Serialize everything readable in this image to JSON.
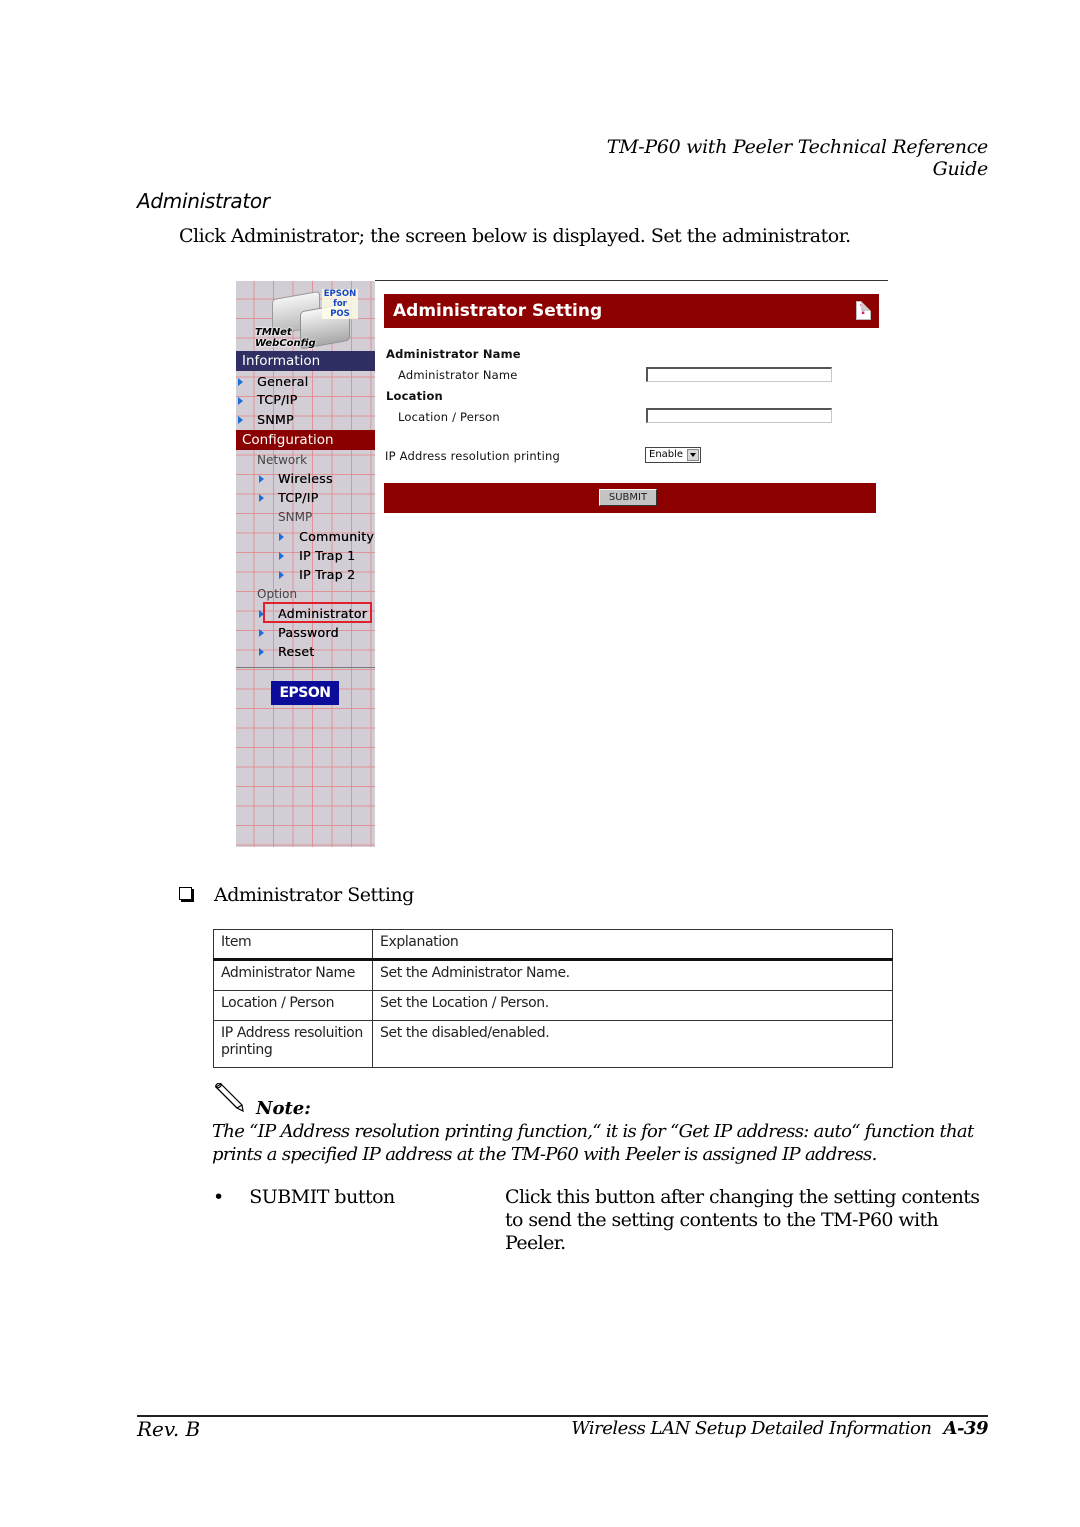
{
  "running_header": "TM-P60 with Peeler Technical Reference Guide",
  "section_title": "Administrator",
  "intro": "Click Administrator; the screen below is displayed. Set the administrator.",
  "screenshot": {
    "logo": {
      "badge_line1": "EPSON",
      "badge_line2": "for",
      "badge_line3": "POS",
      "name_line1": "TMNet",
      "name_line2": "WebConfig"
    },
    "sidebar": {
      "information_header": "Information",
      "information_items": [
        "General",
        "TCP/IP",
        "SNMP"
      ],
      "configuration_header": "Configuration",
      "network_label": "Network",
      "network_items": [
        "Wireless",
        "TCP/IP"
      ],
      "snmp_label": "SNMP",
      "snmp_items": [
        "Community",
        "IP Trap 1",
        "IP Trap 2"
      ],
      "option_label": "Option",
      "option_items": [
        "Administrator",
        "Password",
        "Reset"
      ],
      "selected_item": "Administrator",
      "epson_button": "EPSON"
    },
    "panel": {
      "title": "Administrator Setting",
      "help_icon": "?",
      "admin_name_section": "Administrator Name",
      "admin_name_label": "Administrator Name",
      "admin_name_value": "",
      "location_section": "Location",
      "location_label": "Location / Person",
      "location_value": "",
      "ip_resolution_label": "IP Address resolution printing",
      "ip_resolution_value": "Enable",
      "submit_label": "SUBMIT"
    },
    "colors": {
      "title_bar": "#8c0000",
      "information_header": "#2f2f63",
      "configuration_header": "#8a0000",
      "selection_outline": "#e0202a",
      "nav_arrow": "#1a6fd8",
      "epson_button": "#0c0c9a"
    }
  },
  "subheading": "Administrator Setting",
  "table": {
    "headers": [
      "Item",
      "Explanation"
    ],
    "rows": [
      [
        "Administrator Name",
        "Set the Administrator Name."
      ],
      [
        "Location / Person",
        "Set the Location / Person."
      ],
      [
        "IP Address resoluition printing",
        "Set the disabled/enabled."
      ]
    ]
  },
  "note": {
    "label": "Note:",
    "text": "The  “IP Address resolution printing function,“ it is for “Get IP address: auto“ function that prints a specified IP address  at the TM-P60 with Peeler is assigned IP address."
  },
  "bullets": [
    {
      "term": "SUBMIT button",
      "description": "Click this button after changing the setting contents to send the setting contents to the TM-P60 with Peeler."
    }
  ],
  "footer": {
    "left": "Rev. B",
    "right": "Wireless LAN Setup Detailed Information",
    "page": "A-39"
  }
}
